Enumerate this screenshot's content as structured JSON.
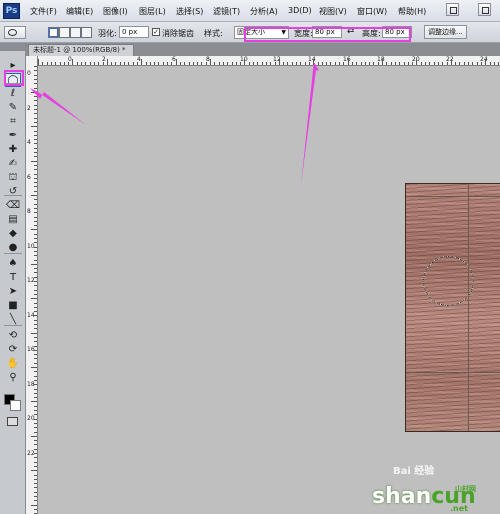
{
  "app": {
    "logo": "Ps"
  },
  "menubar": {
    "items": [
      "文件(F)",
      "编辑(E)",
      "图像(I)",
      "图层(L)",
      "选择(S)",
      "滤镜(T)",
      "分析(A)",
      "3D(D)",
      "视图(V)",
      "窗口(W)",
      "帮助(H)"
    ]
  },
  "options": {
    "feather_label": "羽化:",
    "feather_value": "0 px",
    "antialias_label": "消除锯齿",
    "antialias_checked": true,
    "style_label": "样式:",
    "style_value": "固定大小",
    "width_label": "宽度:",
    "width_value": "80 px",
    "height_label": "高度:",
    "height_value": "80 px",
    "refine_button": "调整边缘...",
    "swap_icon": "swap-arrows-icon"
  },
  "document": {
    "tab_title": "未标题-1 @ 100%(RGB/8) *"
  },
  "ruler": {
    "top_labels": [
      "20",
      "0",
      "2",
      "4",
      "6",
      "8",
      "10",
      "12",
      "14",
      "16",
      "18",
      "20",
      "22",
      "24"
    ],
    "left_labels": [
      "0",
      "2",
      "4",
      "6",
      "8",
      "10",
      "12",
      "14",
      "16",
      "18",
      "20",
      "22"
    ]
  },
  "toolbox": {
    "tools": [
      {
        "name": "move-tool-icon",
        "glyph": "▸"
      },
      {
        "name": "elliptical-marquee-tool-icon",
        "glyph": "◯"
      },
      {
        "name": "lasso-tool-icon",
        "glyph": "ℓ"
      },
      {
        "name": "quick-selection-tool-icon",
        "glyph": "✎"
      },
      {
        "name": "crop-tool-icon",
        "glyph": "⌗"
      },
      {
        "name": "eyedropper-tool-icon",
        "glyph": "✒"
      },
      {
        "name": "spot-healing-tool-icon",
        "glyph": "✚"
      },
      {
        "name": "brush-tool-icon",
        "glyph": "✍"
      },
      {
        "name": "clone-stamp-tool-icon",
        "glyph": "⛫"
      },
      {
        "name": "history-brush-tool-icon",
        "glyph": "↺"
      },
      {
        "name": "eraser-tool-icon",
        "glyph": "⌫"
      },
      {
        "name": "gradient-tool-icon",
        "glyph": "▤"
      },
      {
        "name": "blur-tool-icon",
        "glyph": "◆"
      },
      {
        "name": "dodge-tool-icon",
        "glyph": "●"
      },
      {
        "name": "pen-tool-icon",
        "glyph": "♠"
      },
      {
        "name": "type-tool-icon",
        "glyph": "T"
      },
      {
        "name": "path-selection-tool-icon",
        "glyph": "➤"
      },
      {
        "name": "rectangle-tool-icon",
        "glyph": "■"
      },
      {
        "name": "line-tool-icon",
        "glyph": "╲"
      },
      {
        "name": "3d-rotate-tool-icon",
        "glyph": "⟲"
      },
      {
        "name": "3d-orbit-tool-icon",
        "glyph": "⟳"
      },
      {
        "name": "hand-tool-icon",
        "glyph": "✋"
      },
      {
        "name": "zoom-tool-icon",
        "glyph": "⚲"
      }
    ]
  },
  "colors": {
    "foreground": "#000000",
    "background": "#ffffff",
    "annotation": "#e53fe0"
  },
  "watermark": {
    "brand_white": "shan",
    "brand_green": "cun",
    "tld": ".net",
    "sub": "山村网",
    "baidu": "Bai 经验"
  }
}
